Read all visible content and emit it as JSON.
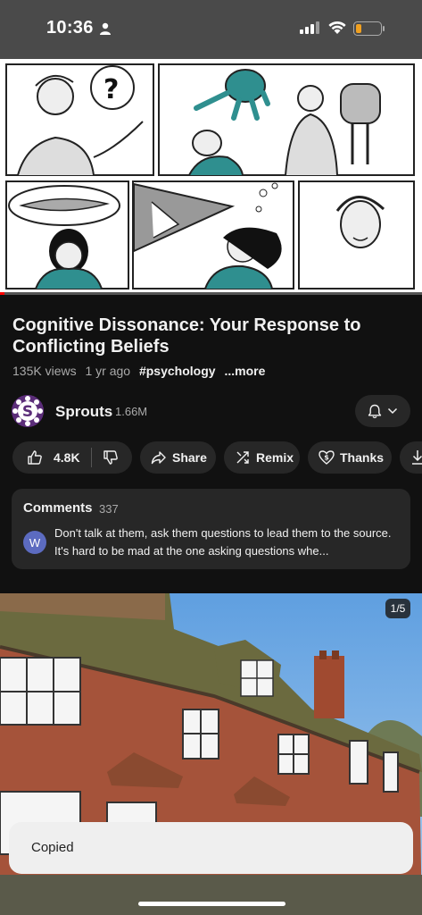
{
  "status_bar": {
    "time": "10:36"
  },
  "video": {
    "progress_fraction": 0.01
  },
  "video_info": {
    "title": "Cognitive Dissonance: Your Response to Conflicting Beliefs",
    "views": "135K views",
    "age": "1 yr ago",
    "hashtag": "#psychology",
    "more_label": "...more"
  },
  "channel": {
    "name": "Sprouts",
    "subscribers": "1.66M",
    "avatar_letter": "S",
    "avatar_color": "#5b2d79"
  },
  "actions": {
    "likes": "4.8K",
    "share_label": "Share",
    "remix_label": "Remix",
    "thanks_label": "Thanks"
  },
  "comments": {
    "title": "Comments",
    "count": "337",
    "top_comment_avatar": "W",
    "top_comment_text": "Don't talk at them, ask them questions to lead them to the source. It's hard to be mad at the one asking questions whe..."
  },
  "next_item": {
    "counter": "1/5"
  },
  "toast": {
    "message": "Copied"
  },
  "colors": {
    "background": "#0f0f0f",
    "pill": "#272727",
    "accent_teal": "#2f8f8f"
  }
}
